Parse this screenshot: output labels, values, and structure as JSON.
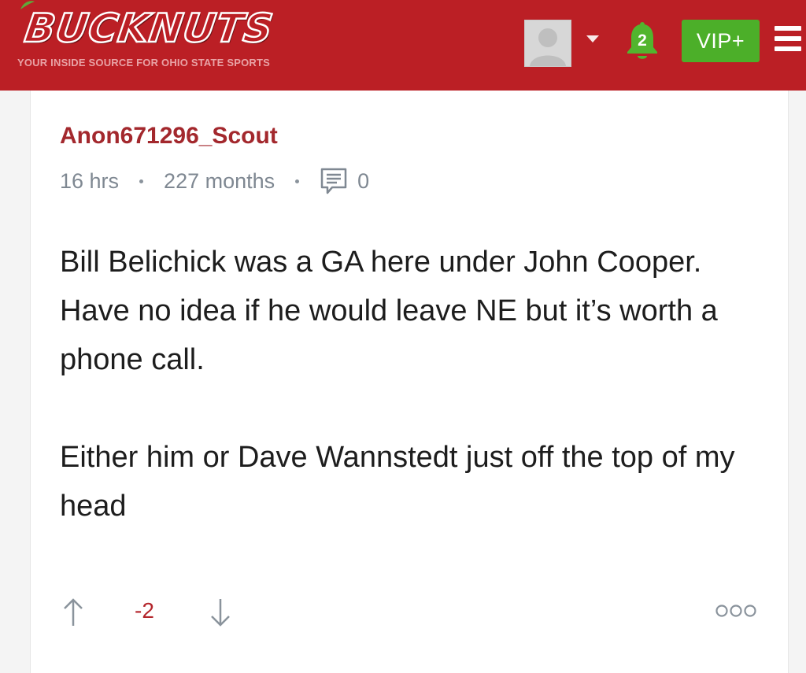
{
  "header": {
    "logo_text": "BUCKNUTS",
    "tagline": "YOUR INSIDE SOURCE FOR OHIO STATE SPORTS",
    "notification_count": "2",
    "vip_label": "VIP+",
    "icons": [
      "avatar",
      "caret-down-icon",
      "bell-icon",
      "menu-icon"
    ],
    "colors": {
      "brand_red": "#bb1f25",
      "vip_green": "#4caf29",
      "bell_green": "#4caf29"
    }
  },
  "post": {
    "author": "Anon671296_Scout",
    "time_ago": "16 hrs",
    "member_age": "227 months",
    "reply_count": "0",
    "paragraphs": [
      "Bill Belichick was a GA here under John Cooper. Have no idea if he would leave NE but it’s worth a phone call.",
      "Either him or Dave Wannstedt just off the top of my head"
    ],
    "score": "-2",
    "icons": [
      "comment-icon",
      "arrow-up-icon",
      "arrow-down-icon",
      "more-icon"
    ],
    "colors": {
      "author": "#a3282d",
      "score": "#b4262c"
    }
  }
}
